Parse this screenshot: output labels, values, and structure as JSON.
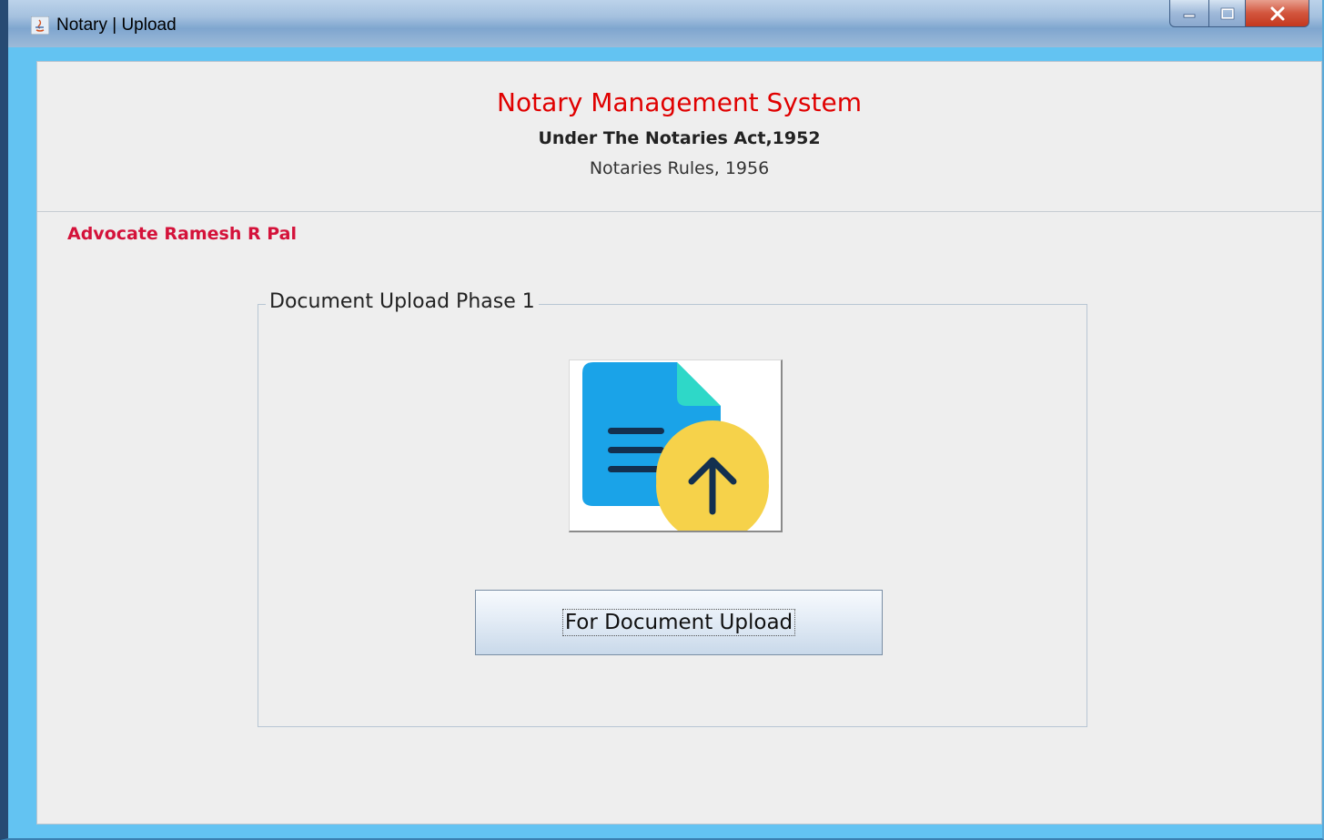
{
  "window": {
    "title": "Notary | Upload",
    "controls": [
      "minimize-icon",
      "maximize-icon",
      "close-icon"
    ]
  },
  "header": {
    "title": "Notary Management System",
    "subtitle": "Under The Notaries Act,1952",
    "rules": "Notaries Rules, 1956"
  },
  "user": {
    "name": "Advocate Ramesh R Pal"
  },
  "upload_panel": {
    "title": "Document Upload Phase 1",
    "icon": "document-upload-icon",
    "button_label": "For Document Upload"
  },
  "colors": {
    "title_red": "#e00000",
    "advocate_red": "#d4123a",
    "frame_blue": "#63c3f2",
    "doc_blue": "#1aa3e8",
    "doc_corner": "#2ed8c8",
    "arrow_circle": "#f6d24a",
    "arrow_navy": "#13304f"
  }
}
